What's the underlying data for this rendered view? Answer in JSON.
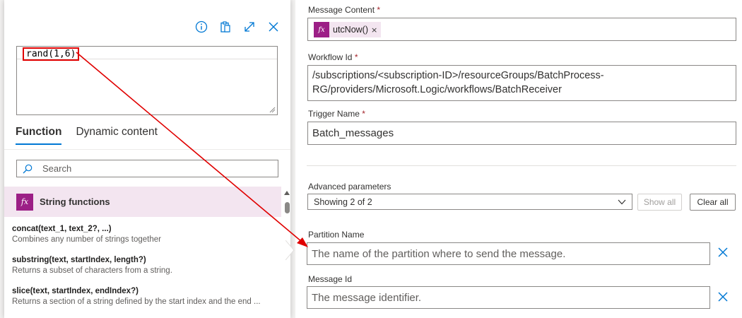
{
  "expression_editor": {
    "expression_text": "rand(1,6)",
    "toolbar": {
      "info_icon": "info-icon",
      "clipboard_icon": "clipboard-icon",
      "expand_icon": "expand-icon",
      "close_icon": "close-icon"
    },
    "tabs": [
      {
        "label": "Function",
        "active": true
      },
      {
        "label": "Dynamic content",
        "active": false
      }
    ],
    "search": {
      "placeholder": "Search"
    },
    "category": {
      "badge": "fx",
      "label": "String functions"
    },
    "functions": [
      {
        "signature": "concat(text_1, text_2?, ...)",
        "description": "Combines any number of strings together"
      },
      {
        "signature": "substring(text, startIndex, length?)",
        "description": "Returns a subset of characters from a string."
      },
      {
        "signature": "slice(text, startIndex, endIndex?)",
        "description": "Returns a section of a string defined by the start index and the end ..."
      }
    ]
  },
  "form": {
    "message_content": {
      "label": "Message Content",
      "required_mark": "*",
      "token": {
        "badge": "fx",
        "label": "utcNow()",
        "remove": "×"
      }
    },
    "workflow_id": {
      "label": "Workflow Id",
      "required_mark": "*",
      "value_line1": "/subscriptions/<subscription-ID>/resourceGroups/BatchProcess-",
      "value_line2": "RG/providers/Microsoft.Logic/workflows/BatchReceiver"
    },
    "trigger_name": {
      "label": "Trigger Name",
      "required_mark": "*",
      "value": "Batch_messages"
    },
    "advanced_parameters": {
      "label": "Advanced parameters",
      "selected": "Showing 2 of 2",
      "show_all_label": "Show all",
      "clear_all_label": "Clear all"
    },
    "partition_name": {
      "label": "Partition Name",
      "placeholder": "The name of the partition where to send the message."
    },
    "message_id": {
      "label": "Message Id",
      "placeholder": "The message identifier."
    }
  },
  "colors": {
    "accent": "#0078d4",
    "function_badge": "#9c1f86",
    "function_highlight": "#f3e5f0",
    "annotation_red": "#e00000",
    "required": "#a4262c"
  }
}
